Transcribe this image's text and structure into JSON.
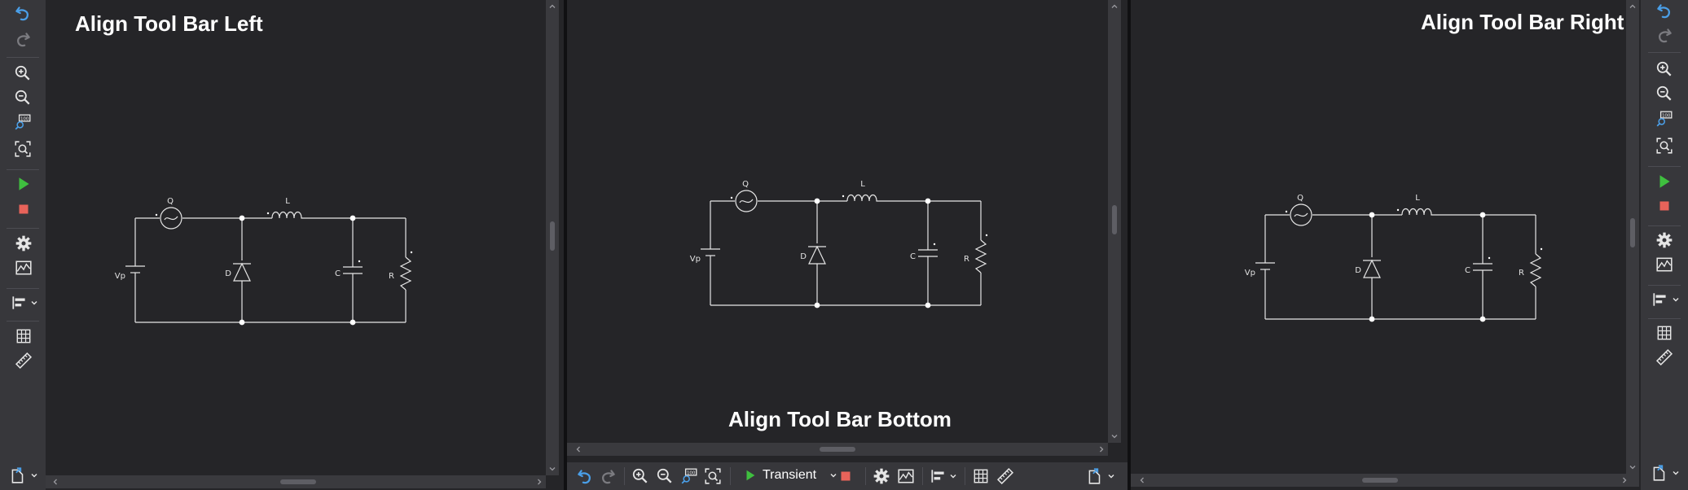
{
  "panels": {
    "left": {
      "title": "Align Tool Bar Left"
    },
    "bottom": {
      "title": "Align Tool Bar Bottom"
    },
    "right": {
      "title": "Align Tool Bar Right"
    }
  },
  "toolbar": {
    "items": [
      "undo-icon",
      "redo-icon",
      "zoom-in-icon",
      "zoom-out-icon",
      "zoom-100-icon",
      "zoom-fit-icon",
      "run-icon",
      "stop-icon",
      "settings-icon",
      "waveform-viewer-icon",
      "align-toolbar-icon",
      "grid-icon",
      "ruler-icon",
      "export-icon"
    ],
    "simulation_mode": "Transient"
  },
  "circuit": {
    "labels": {
      "source": "Vp",
      "switch": "Q",
      "inductor": "L",
      "diode": "D",
      "capacitor": "C",
      "resistor": "R"
    }
  },
  "colors": {
    "background": "#252528",
    "toolbar": "#37373b",
    "undo_blue": "#4a9fe8",
    "run_green": "#3fbf3f",
    "stop_red": "#e8635a",
    "wire": "#e6e6e6"
  }
}
